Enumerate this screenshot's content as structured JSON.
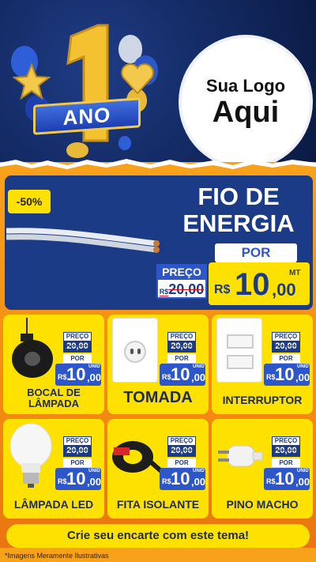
{
  "banner": {
    "anniversary_number": "1",
    "anniversary_word": "ANO",
    "logo_line1": "Sua Logo",
    "logo_line2": "Aqui"
  },
  "hero": {
    "discount_badge": "-50%",
    "title_line1": "FIO DE",
    "title_line2": "ENERGIA",
    "por_label": "POR",
    "preco_label": "PREÇO",
    "old_price_prefix": "R$",
    "old_price": "20,00",
    "currency": "R$",
    "price_int": "10",
    "price_dec": ",00",
    "unit": "MT"
  },
  "products": [
    {
      "name_line1": "BOCAL DE",
      "name_line2": "LÂMPADA",
      "preco_label": "PREÇO",
      "old_price": "20,00",
      "por_label": "POR",
      "currency": "R$",
      "price_int": "10",
      "price_dec": ",00",
      "unit": "UNID"
    },
    {
      "name_line1": "TOMADA",
      "name_line2": "",
      "preco_label": "PREÇO",
      "old_price": "20,00",
      "por_label": "POR",
      "currency": "R$",
      "price_int": "10",
      "price_dec": ",00",
      "unit": "UNID"
    },
    {
      "name_line1": "INTERRUPTOR",
      "name_line2": "",
      "preco_label": "PREÇO",
      "old_price": "20,00",
      "por_label": "POR",
      "currency": "R$",
      "price_int": "10",
      "price_dec": ",00",
      "unit": "UNID"
    },
    {
      "name_line1": "LÂMPADA LED",
      "name_line2": "",
      "preco_label": "PREÇO",
      "old_price": "20,00",
      "por_label": "POR",
      "currency": "R$",
      "price_int": "10",
      "price_dec": ",00",
      "unit": "UNID"
    },
    {
      "name_line1": "FITA ISOLANTE",
      "name_line2": "",
      "preco_label": "PREÇO",
      "old_price": "20,00",
      "por_label": "POR",
      "currency": "R$",
      "price_int": "10",
      "price_dec": ",00",
      "unit": "UNID"
    },
    {
      "name_line1": "PINO MACHO",
      "name_line2": "",
      "preco_label": "PREÇO",
      "old_price": "20,00",
      "por_label": "POR",
      "currency": "R$",
      "price_int": "10",
      "price_dec": ",00",
      "unit": "UNID"
    }
  ],
  "cta": "Crie seu encarte com este tema!",
  "footnote": "*Imagens Meramente Ilustrativas"
}
